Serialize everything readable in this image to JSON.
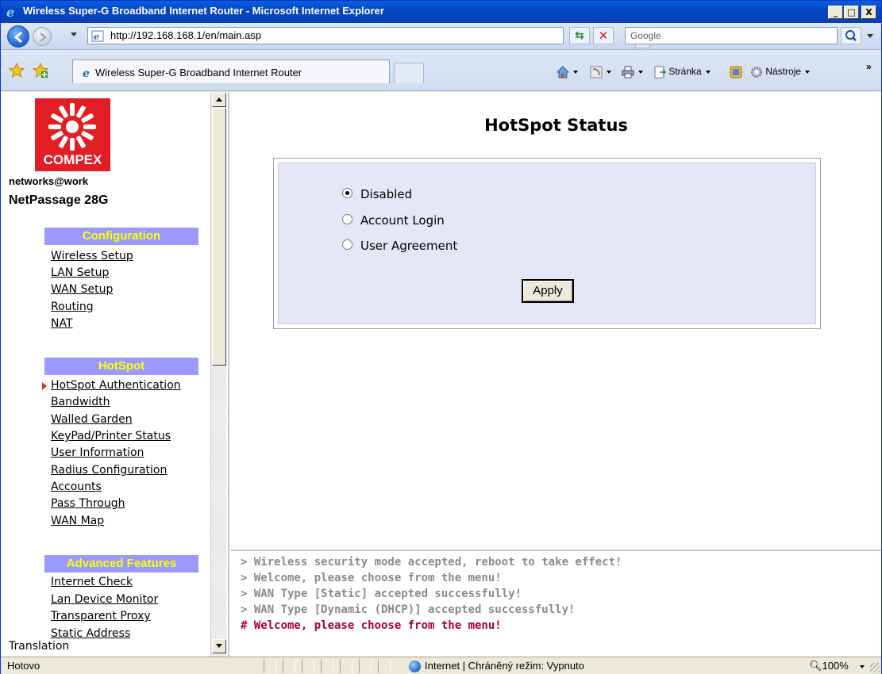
{
  "window": {
    "title": "Wireless Super-G Broadband Internet Router - Microsoft Internet Explorer",
    "minimize": "_",
    "maximize": "□",
    "close": "X"
  },
  "address": {
    "url": "http://192.168.168.1/en/main.asp",
    "search_placeholder": "Google"
  },
  "tab": {
    "label": "Wireless Super-G Broadband Internet Router"
  },
  "commands": {
    "page": "Stránka",
    "tools": "Nástroje",
    "more": "»"
  },
  "sidebar": {
    "brand": "COMPEX",
    "tagline": "networks@work",
    "model": "NetPassage 28G",
    "sections": [
      {
        "title": "Configuration",
        "items": [
          "Wireless Setup",
          "LAN Setup",
          "WAN Setup",
          "Routing",
          "NAT"
        ]
      },
      {
        "title": "HotSpot",
        "items": [
          "HotSpot Authentication",
          "Bandwidth",
          "Walled Garden",
          "KeyPad/Printer Status",
          "User Information",
          "Radius Configuration",
          "Accounts",
          "Pass Through",
          "WAN Map"
        ]
      },
      {
        "title": "Advanced Features",
        "items": [
          "Internet Check",
          "Lan Device Monitor",
          "Transparent Proxy",
          "Static Address"
        ]
      }
    ],
    "current_item": "HotSpot Authentication",
    "translation": "Translation"
  },
  "main": {
    "title": "HotSpot Status",
    "options": [
      "Disabled",
      "Account Login",
      "User Agreement"
    ],
    "selected": "Disabled",
    "apply": "Apply"
  },
  "messages": [
    "> Wireless security mode accepted, reboot to take effect!",
    "> Welcome, please choose from the menu!",
    "> WAN Type [Static] accepted successfully!",
    "> WAN Type [Dynamic (DHCP)] accepted successfully!",
    "# Welcome, please choose from the menu!"
  ],
  "statusbar": {
    "status": "Hotovo",
    "zone": "Internet | Chráněný režim: Vypnuto",
    "zoom": "100%"
  },
  "colors": {
    "section_header_bg": "#9999ff",
    "section_header_text": "#ffff00",
    "logo_red": "#e31d24",
    "panel_bg": "#e6e7f6",
    "active_message": "#a0003a"
  }
}
